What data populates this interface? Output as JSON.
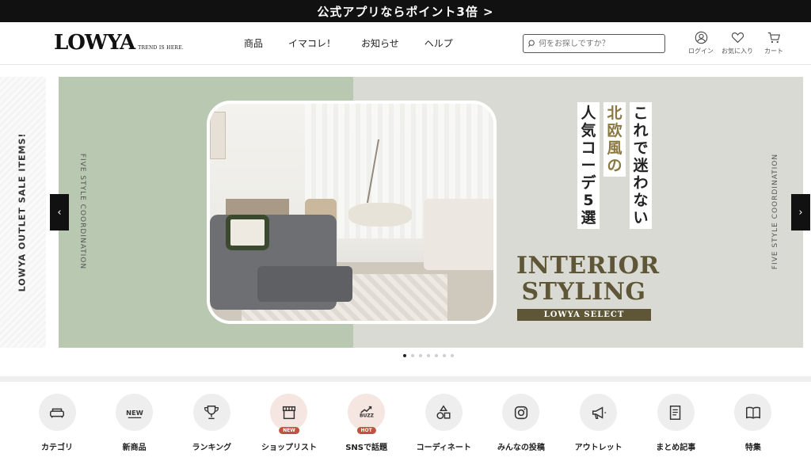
{
  "promo": {
    "text": "公式アプリならポイント3倍 >"
  },
  "header": {
    "logo": "LOWYA",
    "tagline": "TREND IS HERE.",
    "nav": [
      "商品",
      "イマコレ！",
      "お知らせ",
      "ヘルプ"
    ],
    "search_placeholder": "何をお探しですか？",
    "icons": [
      {
        "icon": "user-icon",
        "label": "ログイン"
      },
      {
        "icon": "heart-icon",
        "label": "お気に入り"
      },
      {
        "icon": "cart-icon",
        "label": "カート"
      }
    ]
  },
  "hero": {
    "side_left": "LOWYA OUTLET SALE ITEMS!",
    "vertical_left": "FIVE STYLE COORDINATION",
    "vertical_right": "FIVE STYLE COORDINATION",
    "jp_col1": "これで迷わない",
    "jp_col2": "北欧風の",
    "jp_col3": "人気コーデ5選",
    "title_line1": "INTERIOR",
    "title_line2": "STYLING",
    "subtitle": "LOWYA SELECT",
    "prev": "‹",
    "next": "›",
    "dot_count": 7,
    "active_dot": 0
  },
  "categories": [
    {
      "icon": "sofa-icon",
      "label": "カテゴリ"
    },
    {
      "icon": "new-icon",
      "label": "新商品"
    },
    {
      "icon": "trophy-icon",
      "label": "ランキング"
    },
    {
      "icon": "shop-icon",
      "label": "ショップリスト",
      "badge": "NEW",
      "highlight": true
    },
    {
      "icon": "buzz-icon",
      "label": "SNSで話題",
      "badge": "HOT",
      "highlight": true
    },
    {
      "icon": "shapes-icon",
      "label": "コーディネート"
    },
    {
      "icon": "instagram-icon",
      "label": "みんなの投稿"
    },
    {
      "icon": "megaphone-icon",
      "label": "アウトレット"
    },
    {
      "icon": "article-icon",
      "label": "まとめ記事"
    },
    {
      "icon": "book-icon",
      "label": "特集"
    }
  ],
  "colors": {
    "green": "#b9c8b1",
    "grey": "#dadad5",
    "gold": "#5e5636",
    "badge": "#c0533d"
  }
}
